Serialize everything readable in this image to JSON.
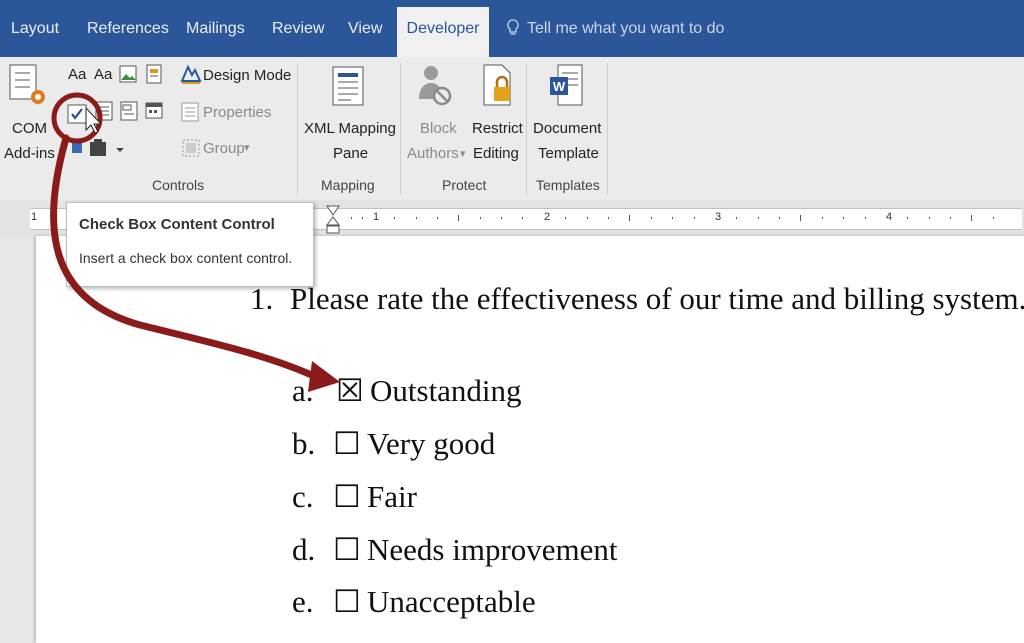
{
  "tabs": {
    "layout": "Layout",
    "references": "References",
    "mailings": "Mailings",
    "review": "Review",
    "view": "View",
    "developer": "Developer",
    "tell_me": "Tell me what you want to do"
  },
  "ribbon": {
    "com_addins_line1": "COM",
    "com_addins_line2": "Add-ins",
    "design_mode": "Design Mode",
    "properties": "Properties",
    "group": "Group",
    "controls_label": "Controls",
    "xml_mapping_line1": "XML Mapping",
    "xml_mapping_line2": "Pane",
    "mapping_label": "Mapping",
    "block_line1": "Block",
    "block_line2": "Authors",
    "restrict_line1": "Restrict",
    "restrict_line2": "Editing",
    "protect_label": "Protect",
    "document_line1": "Document",
    "document_line2": "Template",
    "templates_label": "Templates",
    "aa1": "Aa",
    "aa2": "Aa"
  },
  "ruler": {
    "marks": [
      "1",
      "1",
      "2",
      "3",
      "4"
    ]
  },
  "tooltip": {
    "title": "Check Box Content Control",
    "description": "Insert a check box content control."
  },
  "document": {
    "question_number": "1.",
    "question": "Please rate the effectiveness of our time and billing system.",
    "options": [
      {
        "letter": "a.",
        "checkbox": "☒",
        "label": "Outstanding",
        "checked": true
      },
      {
        "letter": "b.",
        "checkbox": "☐",
        "label": "Very good",
        "checked": false
      },
      {
        "letter": "c.",
        "checkbox": "☐",
        "label": "Fair",
        "checked": false
      },
      {
        "letter": "d.",
        "checkbox": "☐",
        "label": "Needs improvement",
        "checked": false
      },
      {
        "letter": "e.",
        "checkbox": "☐",
        "label": "Unacceptable",
        "checked": false
      }
    ]
  },
  "colors": {
    "tabbar": "#2b579a",
    "annotation_arrow": "#8b1a1a"
  }
}
